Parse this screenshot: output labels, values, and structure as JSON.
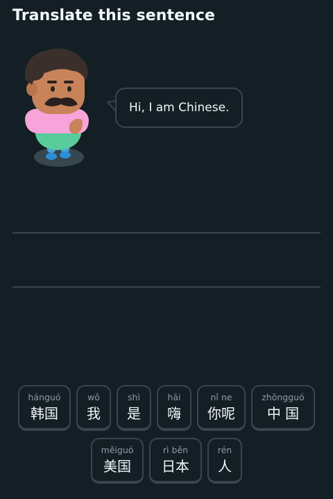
{
  "header": {
    "title": "Translate this sentence"
  },
  "prompt": {
    "bubble_text": "Hi, I am Chinese."
  },
  "word_bank": {
    "row1": [
      {
        "pinyin": "hánguó",
        "hanzi": "韩国"
      },
      {
        "pinyin": "wǒ",
        "hanzi": "我"
      },
      {
        "pinyin": "shì",
        "hanzi": "是"
      },
      {
        "pinyin": "hāi",
        "hanzi": "嗨"
      },
      {
        "pinyin": "nǐ ne",
        "hanzi": "你呢"
      },
      {
        "pinyin": "zhōngguó",
        "hanzi": "中 国"
      }
    ],
    "row2": [
      {
        "pinyin": "měiguó",
        "hanzi": "美国"
      },
      {
        "pinyin": "rì běn",
        "hanzi": "日本"
      },
      {
        "pinyin": "rén",
        "hanzi": "人"
      }
    ]
  },
  "icons": {
    "character": "character-illustration"
  },
  "colors": {
    "background": "#131f24",
    "border": "#37464f",
    "text": "#f1f7fb",
    "pinyin": "#8b9ca6"
  }
}
